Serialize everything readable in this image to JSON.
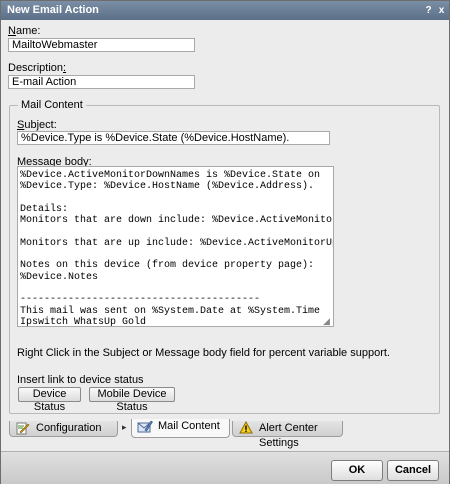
{
  "window": {
    "title": "New Email Action",
    "help_glyph": "?",
    "close_glyph": "x"
  },
  "form": {
    "name_label_prefix": "N",
    "name_label_rest": "ame:",
    "name_value": "MailtoWebmaster",
    "description_label_prefix": "Description",
    "description_label_underlined": ":",
    "description_value": "E-mail Action"
  },
  "mail_content": {
    "legend": "Mail Content",
    "subject_label_underlined": "S",
    "subject_label_rest": "ubject:",
    "subject_value": "%Device.Type is %Device.State (%Device.HostName).",
    "body_label_prefix": "Message ",
    "body_label_underlined": "b",
    "body_label_rest": "ody:",
    "body_value": "%Device.ActiveMonitorDownNames is %Device.State on\n%Device.Type: %Device.HostName (%Device.Address).\n\nDetails:\nMonitors that are down include: %Device.ActiveMonitorDownNames\n\nMonitors that are up include: %Device.ActiveMonitorUpNames\n\nNotes on this device (from device property page):\n%Device.Notes\n\n----------------------------------------\nThis mail was sent on %System.Date at %System.Time\nIpswitch WhatsUp Gold",
    "hint": "Right Click in the Subject or Message body field for percent variable support.",
    "insert_link_label": "Insert link to device status",
    "device_status_button": "Device Status",
    "mobile_device_status_button": "Mobile Device Status"
  },
  "tabs": [
    {
      "label": "Configuration",
      "icon": "pencil-page-icon"
    },
    {
      "label": "Mail Content",
      "icon": "edit-envelope-icon"
    },
    {
      "label": "Alert Center Settings",
      "icon": "warning-icon"
    }
  ],
  "tab_arrow": "▸",
  "buttons": {
    "ok": "OK",
    "cancel": "Cancel"
  }
}
